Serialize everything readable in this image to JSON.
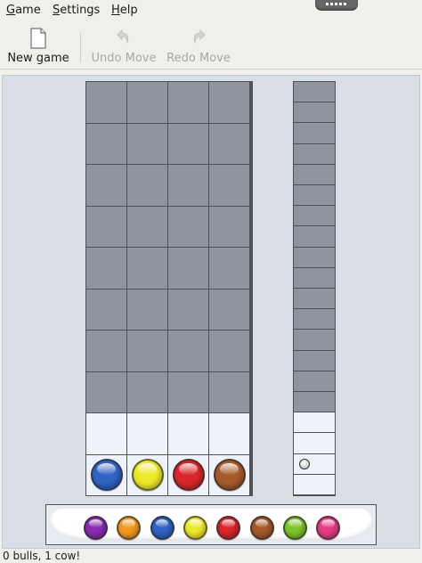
{
  "menu": {
    "items": [
      {
        "label": "Game",
        "mnemonic": "G",
        "rest": "ame"
      },
      {
        "label": "Settings",
        "mnemonic": "S",
        "rest": "ettings"
      },
      {
        "label": "Help",
        "mnemonic": "H",
        "rest": "elp"
      }
    ]
  },
  "toolbar": {
    "new_game": {
      "label": "New game",
      "icon": "new-document-icon",
      "enabled": true
    },
    "undo": {
      "label": "Undo Move",
      "icon": "undo-icon",
      "enabled": false
    },
    "redo": {
      "label": "Redo Move",
      "icon": "redo-icon",
      "enabled": false
    }
  },
  "board": {
    "rows_total": 10,
    "columns": 4,
    "rows_unused": 8,
    "current_guess": [
      {
        "color": "blue",
        "hex": "#2f63c4"
      },
      {
        "color": "yellow",
        "hex": "#ece82a"
      },
      {
        "color": "red",
        "hex": "#d8262a"
      },
      {
        "color": "brown",
        "hex": "#a65a2a"
      }
    ],
    "score": {
      "bulls": 0,
      "cows": 1
    }
  },
  "palette": [
    {
      "color": "purple",
      "hex": "#8a2bb0"
    },
    {
      "color": "orange",
      "hex": "#f39a1e"
    },
    {
      "color": "blue",
      "hex": "#2f63c4"
    },
    {
      "color": "yellow",
      "hex": "#ece82a"
    },
    {
      "color": "red",
      "hex": "#d8262a"
    },
    {
      "color": "brown",
      "hex": "#a65a2a"
    },
    {
      "color": "green",
      "hex": "#7ec42a"
    },
    {
      "color": "pink",
      "hex": "#e63d86"
    }
  ],
  "status": {
    "text": "0 bulls, 1 cow!"
  },
  "colors": {
    "board_bg": "#d8dde6",
    "filled_cell": "#8f959e",
    "empty_cell": "#eef2fb",
    "grid_line": "#4f5359"
  }
}
